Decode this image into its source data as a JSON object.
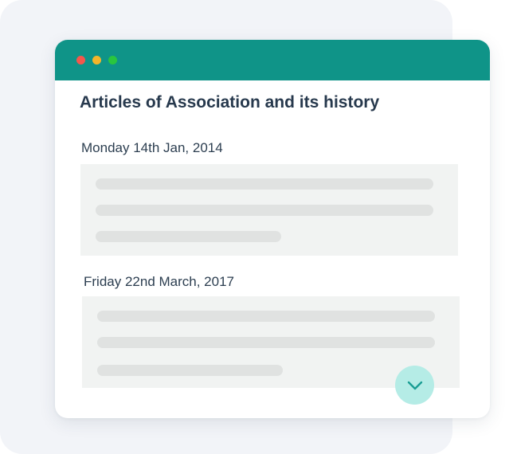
{
  "window": {
    "controls": [
      "close",
      "minimize",
      "maximize"
    ],
    "colors": {
      "titlebar": "#0f9488",
      "close": "#f5574c",
      "minimize": "#f4b52a",
      "maximize": "#29c63f",
      "scroll_button": "#b5ece6",
      "scroll_icon": "#1a9e94"
    }
  },
  "page": {
    "title": "Articles of Association and its history"
  },
  "entries": [
    {
      "date": "Monday 14th Jan, 2014",
      "content_placeholder_lines": 3
    },
    {
      "date": "Friday 22nd March, 2017",
      "content_placeholder_lines": 3
    }
  ],
  "scroll_button": {
    "icon": "chevron-down-icon"
  }
}
